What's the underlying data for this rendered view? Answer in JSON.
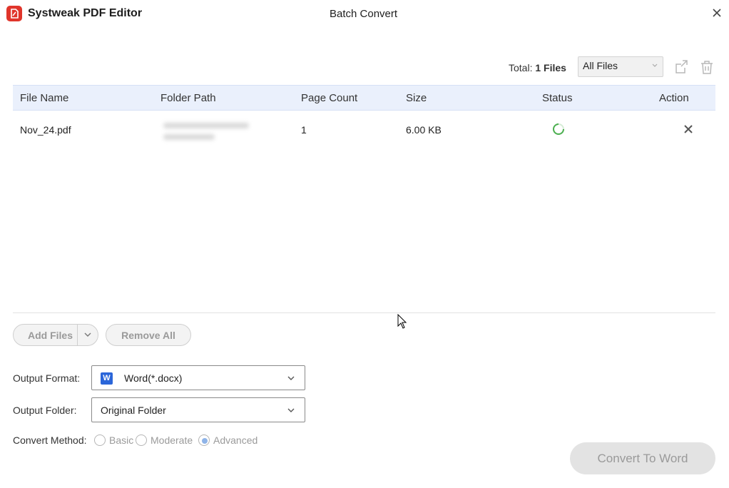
{
  "window": {
    "app_name": "Systweak PDF Editor",
    "title": "Batch Convert"
  },
  "toolbar": {
    "total_label": "Total:",
    "total_value": "1 Files",
    "filter_selected": "All Files"
  },
  "table": {
    "columns": [
      "File Name",
      "Folder Path",
      "Page Count",
      "Size",
      "Status",
      "Action"
    ],
    "rows": [
      {
        "file_name": "Nov_24.pdf",
        "page_count": "1",
        "size": "6.00 KB",
        "status": "loading"
      }
    ]
  },
  "buttons": {
    "add_files": "Add Files",
    "remove_all": "Remove All",
    "convert": "Convert To Word"
  },
  "output": {
    "format_label": "Output Format:",
    "format_value": "Word(*.docx)",
    "format_icon_text": "W",
    "folder_label": "Output Folder:",
    "folder_value": "Original Folder"
  },
  "convert_method": {
    "label": "Convert Method:",
    "options": [
      "Basic",
      "Moderate",
      "Advanced"
    ],
    "selected": "Advanced"
  },
  "colors": {
    "brand": "#e0352b",
    "header_bg": "#eaf0fc",
    "spinner": "#4caf50",
    "word_blue": "#2b66d9"
  }
}
